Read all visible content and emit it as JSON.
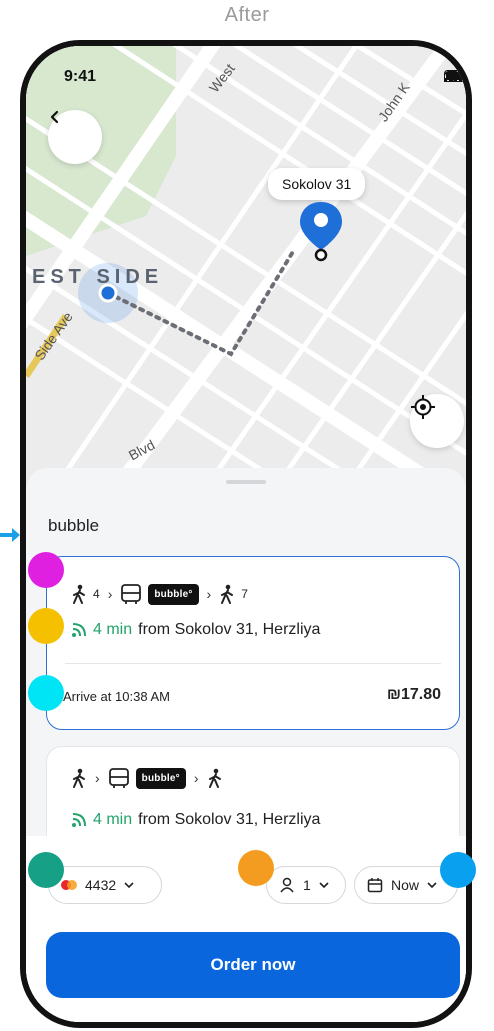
{
  "caption": "After",
  "status": {
    "time": "9:41"
  },
  "map": {
    "area_label": "EST SIDE",
    "streets": [
      "West",
      "John K",
      "Side Ave",
      "Blvd"
    ],
    "destination_label": "Sokolov 31"
  },
  "sheet": {
    "provider": "bubble",
    "cards": [
      {
        "walk_start": "4",
        "bus_badge": "bubble°",
        "walk_end": "7",
        "eta_minutes": "4 min",
        "eta_from": "from Sokolov 31, Herzliya",
        "arrive": "Arrive at 10:38 AM",
        "price": "₪17.80"
      },
      {
        "bus_badge": "bubble°",
        "eta_minutes": "4 min",
        "eta_from": "from Sokolov 31, Herzliya"
      }
    ]
  },
  "bottom": {
    "card_last4": "4432",
    "passengers": "1",
    "time_option": "Now",
    "order_label": "Order now"
  },
  "colors": {
    "accent": "#0a66dc",
    "eta_green": "#22a36b",
    "marker_magenta": "#e020e0",
    "marker_yellow": "#f5c000",
    "marker_cyan": "#00e5f5",
    "marker_teal": "#16a085",
    "marker_orange": "#f39c1f",
    "marker_blue": "#0aa0f0"
  }
}
